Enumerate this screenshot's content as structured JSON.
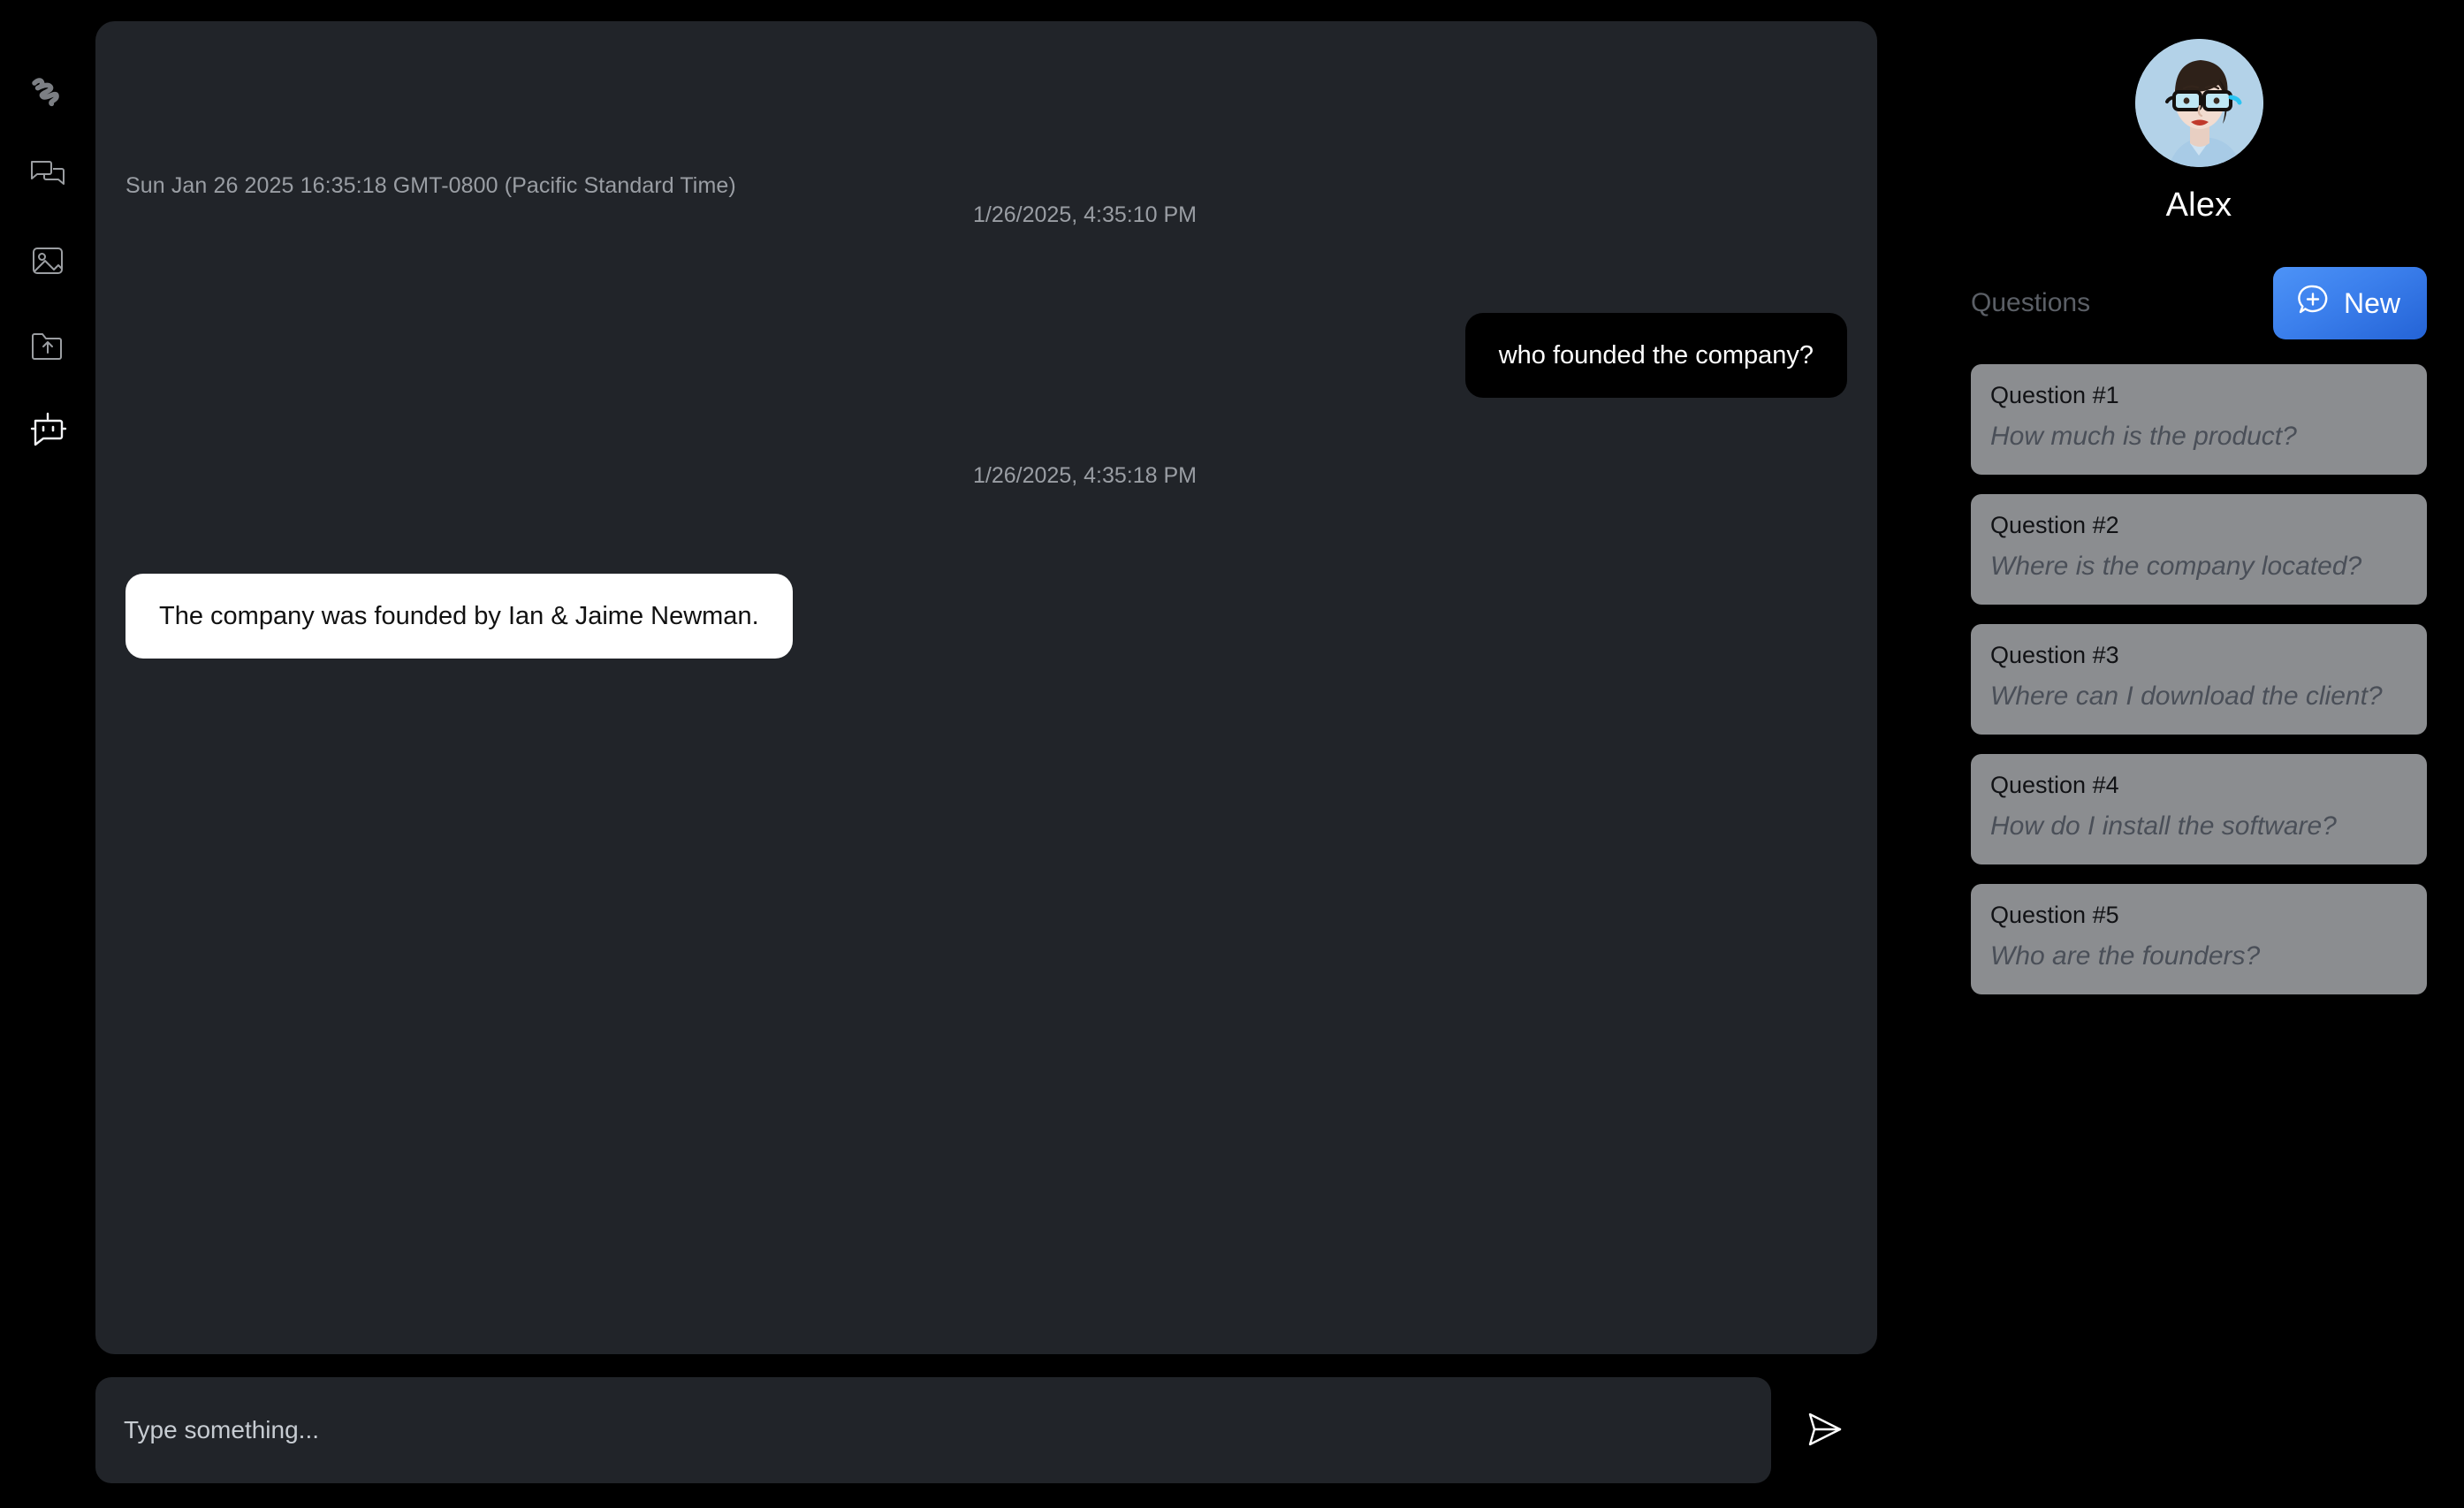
{
  "rail": {
    "logo": {
      "name": "squiggle-logo",
      "label": "Squiggle"
    },
    "items": [
      {
        "id": "chats",
        "icon": "chat-bubbles-icon",
        "label": "Chats"
      },
      {
        "id": "images",
        "icon": "image-icon",
        "label": "Images"
      },
      {
        "id": "upload",
        "icon": "folder-upload-icon",
        "label": "Upload"
      },
      {
        "id": "bot",
        "icon": "bot-icon",
        "label": "Bot",
        "active": true
      }
    ]
  },
  "chat": {
    "session_date": "Sun Jan 26 2025 16:35:18 GMT-0800 (Pacific Standard Time)",
    "messages": [
      {
        "role": "user",
        "timestamp": "1/26/2025, 4:35:10 PM",
        "text": "who founded the company?"
      },
      {
        "role": "bot",
        "timestamp": "1/26/2025, 4:35:18 PM",
        "text": "The company was founded by Ian & Jaime Newman."
      }
    ]
  },
  "composer": {
    "placeholder": "Type something...",
    "value": "",
    "send_icon": "send-paper-plane-icon"
  },
  "profile": {
    "name": "Alex",
    "avatar_alt": "Woman with black glasses on light blue background"
  },
  "questions_panel": {
    "title": "Questions",
    "new_button": {
      "label": "New",
      "icon": "chat-plus-icon",
      "color": "#3b7fec"
    },
    "items": [
      {
        "label": "Question #1",
        "text": "How much is the product?"
      },
      {
        "label": "Question #2",
        "text": "Where is the company located?"
      },
      {
        "label": "Question #3",
        "text": "Where can I download the client?"
      },
      {
        "label": "Question #4",
        "text": "How do I install the software?"
      },
      {
        "label": "Question #5",
        "text": "Who are the founders?"
      }
    ]
  },
  "colors": {
    "background": "#000000",
    "panel": "#212429",
    "user_bubble": "#000000",
    "bot_bubble": "#ffffff",
    "card": "#8b8d90",
    "accent": "#3b7fec",
    "muted_text": "#9a9ea4"
  }
}
